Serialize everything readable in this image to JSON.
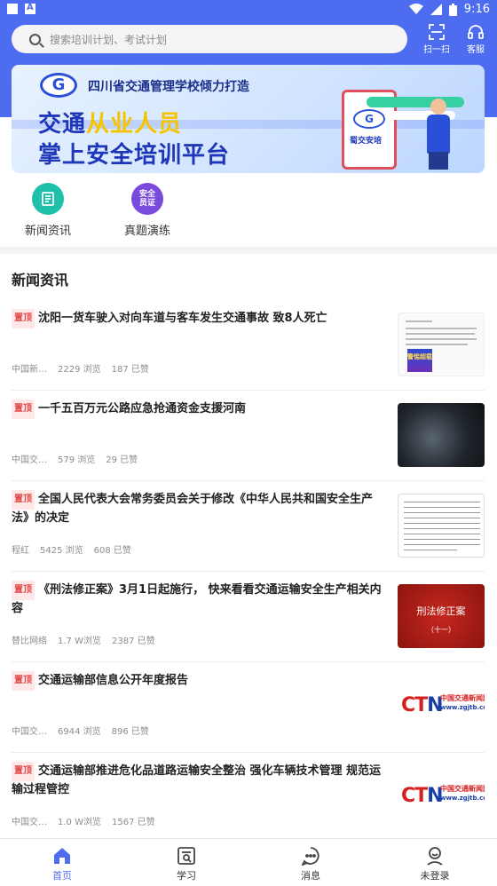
{
  "status_bar": {
    "time": "9:16"
  },
  "header": {
    "search_placeholder": "搜索培训计划、考试计划",
    "scan_label": "扫一扫",
    "service_label": "客服"
  },
  "banner": {
    "subtitle": "四川省交通管理学校倾力打造",
    "line1_a": "交通",
    "line1_b": "从业人员",
    "line2": "掌上安全培训平台",
    "device_text": "蜀交安培"
  },
  "quick_links": [
    {
      "label": "新闻资讯",
      "icon": "news-icon",
      "color": "#1fc0a9"
    },
    {
      "label": "真题演练",
      "icon": "exam-icon",
      "color": "#7a4bdc",
      "icon_text": "安全员证"
    }
  ],
  "section_title": "新闻资讯",
  "pin_tag": "置顶",
  "news": [
    {
      "title": "沈阳一货车驶入对向车道与客车发生交通事故 致8人死亡",
      "source": "中国新…",
      "views": "2229 浏览",
      "likes": "187 已赞",
      "thumb_text": "警惕超载"
    },
    {
      "title": "一千五百万元公路应急抢通资金支援河南",
      "source": "中国交…",
      "views": "579 浏览",
      "likes": "29 已赞"
    },
    {
      "title": "全国人民代表大会常务委员会关于修改《中华人民共和国安全生产法》的决定",
      "source": "程红",
      "views": "5425 浏览",
      "likes": "608 已赞"
    },
    {
      "title": "《刑法修正案》3月1日起施行， 快来看看交通运输安全生产相关内容",
      "source": "替比网络",
      "views": "1.7 W浏览",
      "likes": "2387 已赞",
      "thumb_text": "刑法修正案",
      "thumb_sub": "（十一）"
    },
    {
      "title": "交通运输部信息公开年度报告",
      "source": "中国交…",
      "views": "6944 浏览",
      "likes": "896 已赞",
      "thumb_text": "CTN",
      "thumb_sub": "中国交通新闻网",
      "thumb_url": "www.zgjtb.com"
    },
    {
      "title": "交通运输部推进危化品道路运输安全整治 强化车辆技术管理 规范运输过程管控",
      "source": "中国交…",
      "views": "1.0 W浏览",
      "likes": "1567 已赞",
      "thumb_text": "CTN",
      "thumb_sub": "中国交通新闻网",
      "thumb_url": "www.zgjtb.com"
    }
  ],
  "tabbar": [
    {
      "label": "首页",
      "icon": "home-icon",
      "active": true
    },
    {
      "label": "学习",
      "icon": "study-icon"
    },
    {
      "label": "消息",
      "icon": "message-icon"
    },
    {
      "label": "未登录",
      "icon": "user-icon"
    }
  ],
  "colors": {
    "primary": "#4d6cf0",
    "tag_red": "#e04848"
  }
}
